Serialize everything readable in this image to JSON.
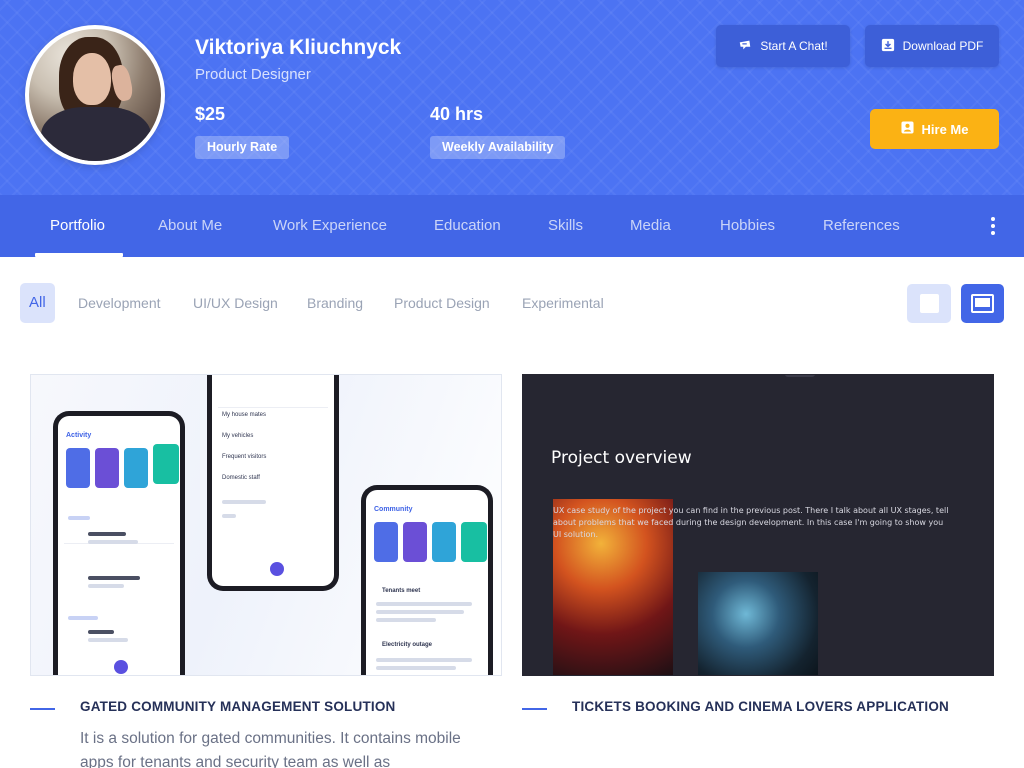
{
  "profile": {
    "name": "Viktoriya Kliuchnyck",
    "role": "Product Designer",
    "hourly_rate_value": "$25",
    "hourly_rate_label": "Hourly Rate",
    "availability_value": "40 hrs",
    "availability_label": "Weekly Availability"
  },
  "actions": {
    "chat_label": "Start A Chat!",
    "download_label": "Download PDF",
    "hire_label": "Hire Me"
  },
  "nav": {
    "items": [
      "Portfolio",
      "About Me",
      "Work Experience",
      "Education",
      "Skills",
      "Media",
      "Hobbies",
      "References"
    ],
    "active": "Portfolio"
  },
  "filters": {
    "items": [
      "All",
      "Development",
      "UI/UX Design",
      "Branding",
      "Product Design",
      "Experimental"
    ],
    "active": "All"
  },
  "projects": [
    {
      "title": "GATED COMMUNITY MANAGEMENT SOLUTION",
      "description": "It is a solution for gated communities. It contains mobile apps for tenants and security team as well as"
    },
    {
      "title": "TICKETS BOOKING AND CINEMA LOVERS APPLICATION",
      "overview_heading": "Project overview",
      "overview_text": "UX case study of the project you can find in the previous post. There I talk about all UX stages, tell about problems that we faced during the design development. In this case I'm going to show you UI solution."
    }
  ],
  "mockup": {
    "activity_title": "Activity",
    "community_title": "Community",
    "menu_items": [
      "My house mates",
      "My vehicles",
      "Frequent visitors",
      "Domestic staff"
    ],
    "feed_items": [
      "Tenants meet",
      "Electricity outage"
    ]
  },
  "colors": {
    "header_bg": "#4c73f3",
    "nav_bg": "#4266e7",
    "accent": "#4266e7",
    "hire_button": "#fbb214"
  }
}
